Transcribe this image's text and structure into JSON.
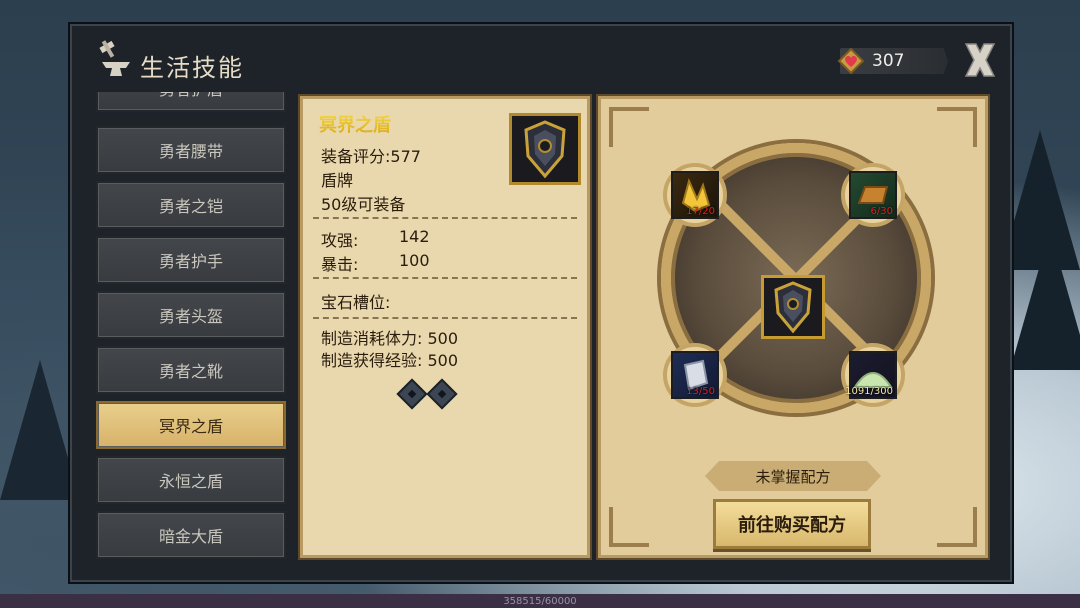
{
  "window": {
    "title": "生活技能"
  },
  "currency": {
    "gems": "307"
  },
  "list": {
    "items": [
      {
        "label": "勇者护盾"
      },
      {
        "label": "勇者腰带"
      },
      {
        "label": "勇者之铠"
      },
      {
        "label": "勇者护手"
      },
      {
        "label": "勇者头盔"
      },
      {
        "label": "勇者之靴"
      },
      {
        "label": "冥界之盾",
        "active": true
      },
      {
        "label": "永恒之盾"
      },
      {
        "label": "暗金大盾"
      }
    ]
  },
  "item": {
    "name": "冥界之盾",
    "score": "装备评分:577",
    "type": "盾牌",
    "level_req": "50级可装备",
    "stat1_label": "攻强:",
    "stat1_value": "142",
    "stat2_label": "暴击:",
    "stat2_value": "100",
    "gem_slots_label": "宝石槽位:",
    "craft_stamina": "制造消耗体力: 500",
    "craft_exp": "制造获得经验: 500"
  },
  "recipe": {
    "materials": [
      {
        "icon": "gold-crystal-icon",
        "count": "17/20"
      },
      {
        "icon": "gold-ingot-icon",
        "count": "6/30"
      },
      {
        "icon": "silver-ore-icon",
        "count": "13/50"
      },
      {
        "icon": "powder-pile-icon",
        "count": "1091/300"
      }
    ],
    "status": "未掌握配方",
    "buy_label": "前往购买配方"
  },
  "footer": {
    "exp": "358515/60000"
  },
  "colors": {
    "active_item": "#d7b26a",
    "panel": "#e9d7ae",
    "count_red": "#e8191c"
  }
}
